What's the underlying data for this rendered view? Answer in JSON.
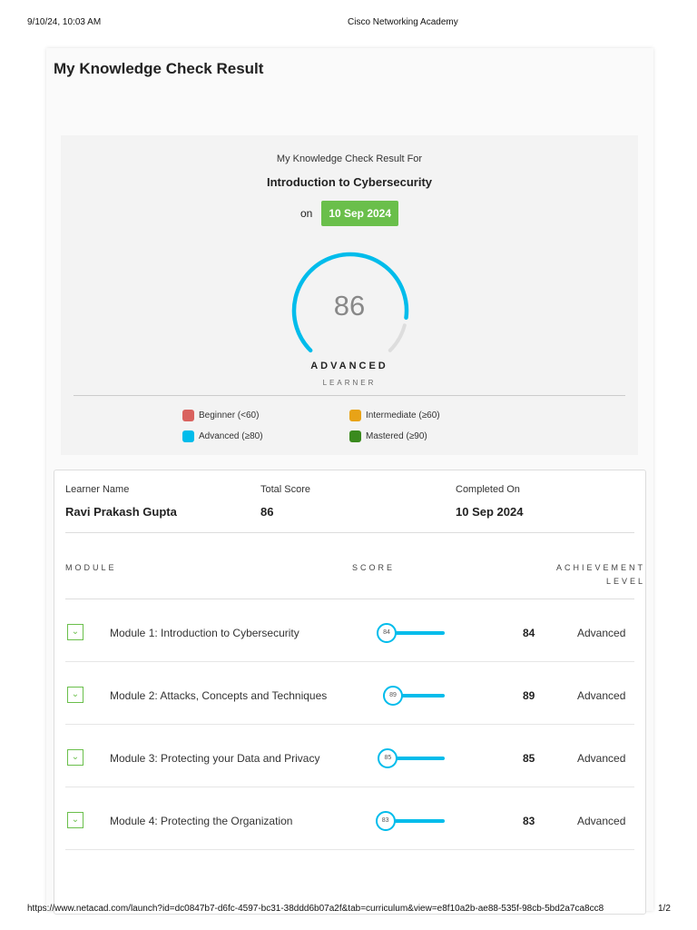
{
  "browser": {
    "datetime": "9/10/24, 10:03 AM",
    "page_title": "Cisco Networking Academy",
    "url": "https://www.netacad.com/launch?id=dc0847b7-d6fc-4597-bc31-38ddd6b07a2f&tab=curriculum&view=e8f10a2b-ae88-535f-98cb-5bd2a7ca8cc8",
    "page_number": "1/2"
  },
  "title": "My Knowledge Check Result",
  "summary": {
    "result_for": "My Knowledge Check Result For",
    "course": "Introduction to Cybersecurity",
    "on": "on",
    "date": "10 Sep 2024",
    "score": "86",
    "score_value": 86,
    "level": "ADVANCED",
    "sublevel": "LEARNER",
    "accent": "#00bceb"
  },
  "legend": [
    {
      "label": "Beginner (<60)",
      "color": "#d9625f"
    },
    {
      "label": "Intermediate (≥60)",
      "color": "#e8a317"
    },
    {
      "label": "Advanced (≥80)",
      "color": "#00bceb"
    },
    {
      "label": "Mastered (≥90)",
      "color": "#3a8a1e"
    }
  ],
  "details": {
    "learner_label": "Learner Name",
    "learner": "Ravi Prakash Gupta",
    "total_label": "Total Score",
    "total": "86",
    "completed_label": "Completed On",
    "completed": "10 Sep 2024"
  },
  "columns": {
    "module": "MODULE",
    "score": "SCORE",
    "achievement1": "ACHIEVEMENT",
    "achievement2": "LEVEL"
  },
  "modules": [
    {
      "name": "Module 1: Introduction to Cybersecurity",
      "score": "84",
      "value": 84,
      "level": "Advanced"
    },
    {
      "name": "Module 2: Attacks, Concepts and Techniques",
      "score": "89",
      "value": 89,
      "level": "Advanced"
    },
    {
      "name": "Module 3: Protecting your Data and Privacy",
      "score": "85",
      "value": 85,
      "level": "Advanced"
    },
    {
      "name": "Module 4: Protecting the Organization",
      "score": "83",
      "value": 83,
      "level": "Advanced"
    }
  ]
}
